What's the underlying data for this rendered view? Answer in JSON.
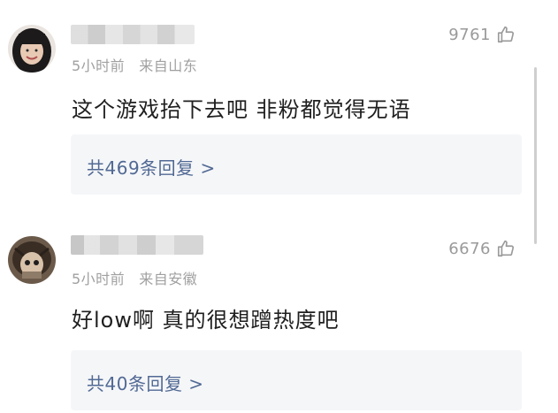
{
  "comments": [
    {
      "time": "5小时前",
      "location": "来自山东",
      "likes": "9761",
      "text": "这个游戏抬下去吧 非粉都觉得无语",
      "replies": "共469条回复 >"
    },
    {
      "time": "5小时前",
      "location": "来自安徽",
      "likes": "6676",
      "text": "好low啊 真的很想蹭热度吧",
      "replies": "共40条回复 >"
    }
  ],
  "icons": {
    "like": "thumbs-up-icon"
  },
  "colors": {
    "link": "#516994",
    "meta": "#a0a0a0",
    "reply_bg": "#f5f6f8"
  }
}
